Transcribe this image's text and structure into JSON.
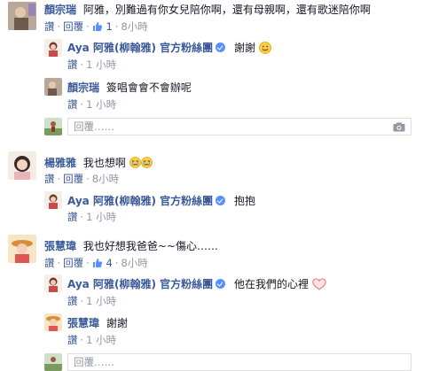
{
  "labels": {
    "like": "讚",
    "reply": "回覆",
    "reply_placeholder": "回覆……"
  },
  "thread1": {
    "comment": {
      "name": "顏宗瑞",
      "text": "阿雅，別難過有你女兒陪你啊，還有母親啊，還有歌迷陪你啊",
      "likes": "1",
      "time": "8小時"
    },
    "replies": [
      {
        "name": "Aya 阿雅(柳翰雅) 官方粉絲團",
        "text": "謝謝",
        "time": "1 小時"
      },
      {
        "name": "顏宗瑞",
        "text": "簽唱會會不會辦呢",
        "time": "1 小時"
      }
    ]
  },
  "thread2": {
    "comment": {
      "name": "楊雅雅",
      "text": "我也想啊",
      "time": "8小時"
    },
    "replies": [
      {
        "name": "Aya 阿雅(柳翰雅) 官方粉絲團",
        "text": "抱抱",
        "time": "1 小時"
      }
    ]
  },
  "thread3": {
    "comment": {
      "name": "張慧瑋",
      "text": "我也好想我爸爸~~傷心……",
      "likes": "4",
      "time": "8小時"
    },
    "replies": [
      {
        "name": "Aya 阿雅(柳翰雅) 官方粉絲團",
        "text": "他在我們的心裡",
        "time": "1 小時"
      },
      {
        "name": "張慧瑋",
        "text": "謝謝",
        "time": "1 小時"
      }
    ]
  },
  "colors": {
    "link": "#3b5998",
    "meta": "#9197a3",
    "text": "#141823",
    "verified": "#5890ff"
  },
  "icons": {
    "like": "thumbs-up-icon",
    "verified": "verified-badge-icon",
    "camera": "camera-icon",
    "smile": "smile-emoji-icon",
    "cry": "crying-emoji-icon",
    "heart": "heart-emoji-icon"
  }
}
